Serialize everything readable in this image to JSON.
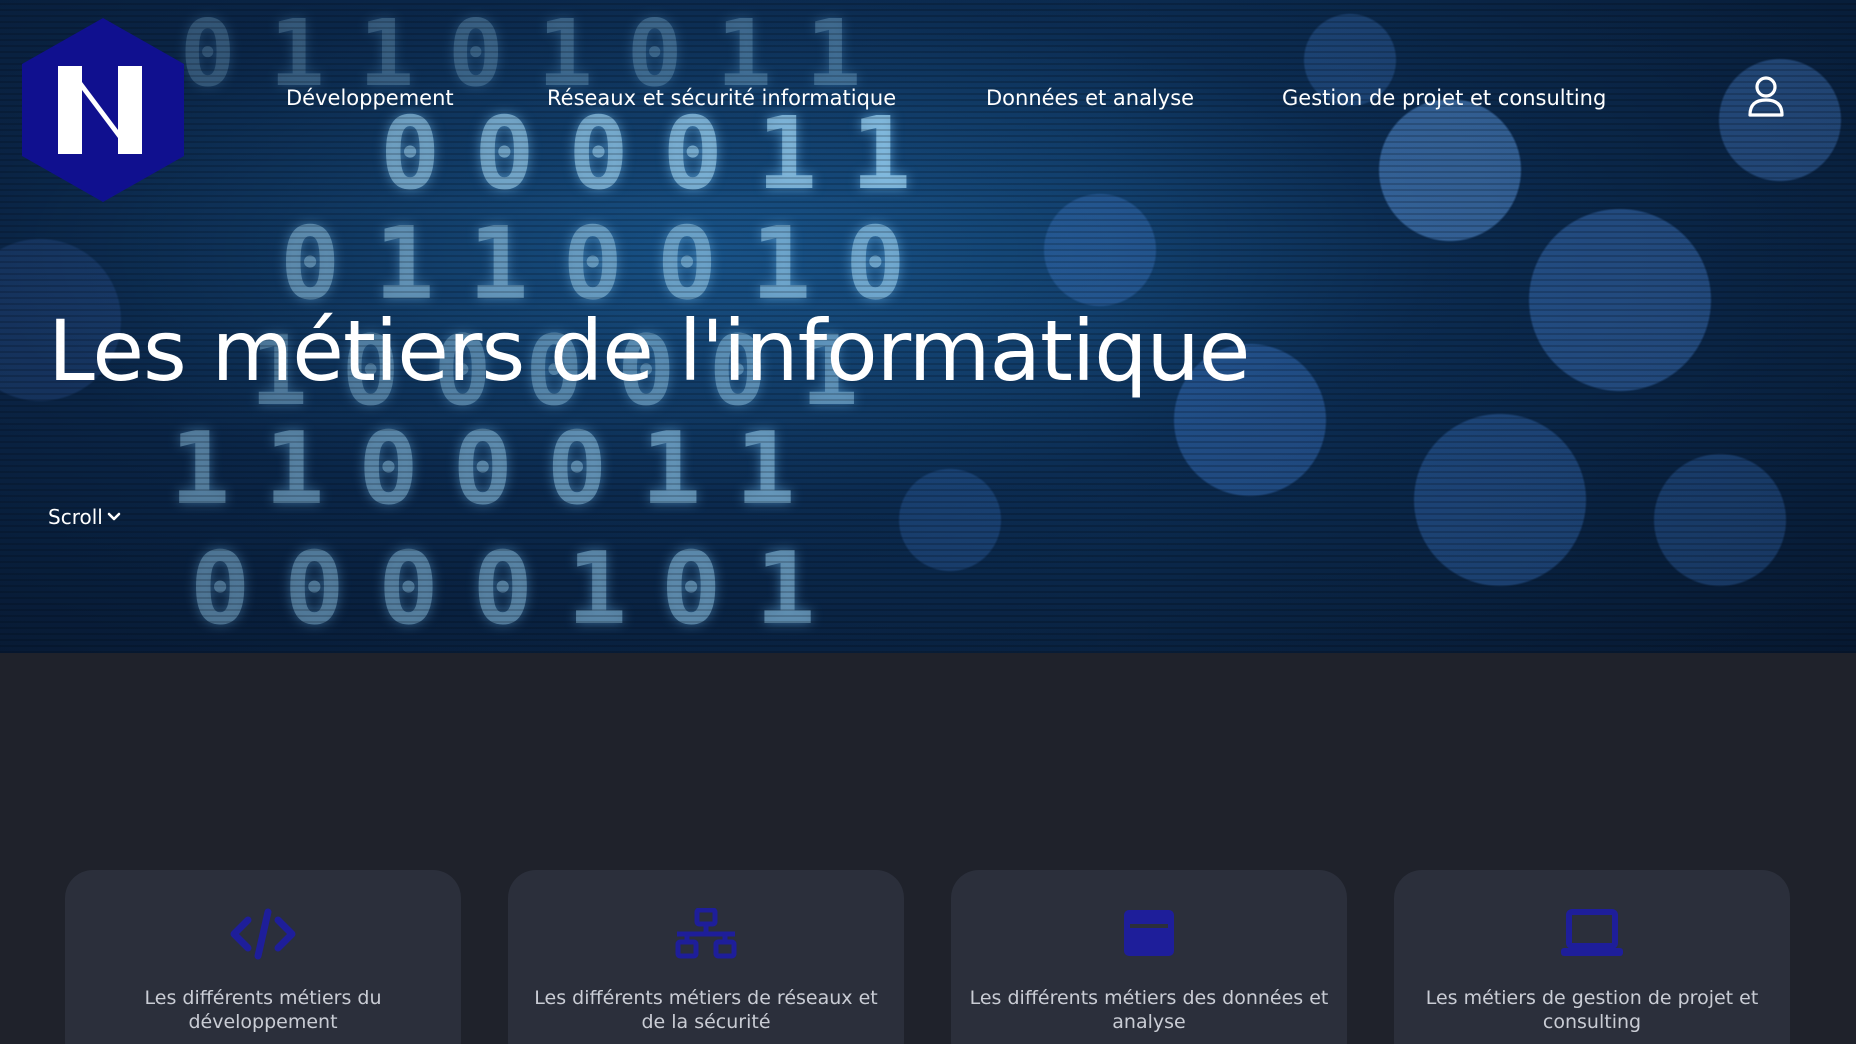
{
  "nav": {
    "items": [
      {
        "label": "Développement"
      },
      {
        "label": "Réseaux et sécurité informatique"
      },
      {
        "label": "Données et analyse"
      },
      {
        "label": "Gestion de projet et consulting"
      }
    ]
  },
  "hero": {
    "title": "Les métiers de l'informatique",
    "scroll_label": "Scroll"
  },
  "cards": [
    {
      "label": "Les différents métiers du développement",
      "icon": "code-icon"
    },
    {
      "label": "Les différents métiers de réseaux et de la sécurité",
      "icon": "network-icon"
    },
    {
      "label": "Les différents métiers des données et analyse",
      "icon": "window-icon"
    },
    {
      "label": "Les métiers de gestion de projet et consulting",
      "icon": "laptop-icon"
    }
  ],
  "colors": {
    "logo_blue": "#10108f",
    "icon_blue": "#1e1e9a",
    "page_bg": "#1f222b",
    "card_bg": "#2b2f3b"
  }
}
